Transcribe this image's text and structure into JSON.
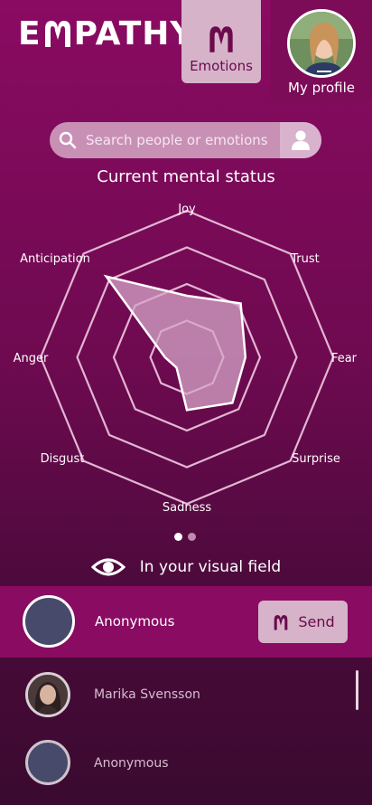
{
  "header": {
    "logo_text_pre": "E",
    "logo_text_post": "PATHY",
    "emotions_tab_label": "Emotions",
    "profile_label": "My profile"
  },
  "search": {
    "placeholder": "Search people or emotions"
  },
  "radar": {
    "title": "Current mental status",
    "axes": [
      "Joy",
      "Trust",
      "Fear",
      "Surprise",
      "Sadness",
      "Disgust",
      "Anger",
      "Anticipation"
    ],
    "values": [
      0.42,
      0.52,
      0.4,
      0.44,
      0.36,
      0.1,
      0.15,
      0.78
    ],
    "levels": 4,
    "fill_color": "#d6a6c8",
    "grid_color": "#e2b6d3"
  },
  "pager": {
    "active_index": 0,
    "count": 2
  },
  "visual_field": {
    "label": "In your visual field"
  },
  "people": [
    {
      "name": "Anonymous",
      "highlighted": true
    },
    {
      "name": "Marika Svensson",
      "highlighted": false
    },
    {
      "name": "Anonymous",
      "highlighted": false
    }
  ],
  "send_label": "Send",
  "colors": {
    "brand": "#8a0b62",
    "accent_light": "#d6b3c9",
    "avatar_placeholder": "#474a6b"
  }
}
